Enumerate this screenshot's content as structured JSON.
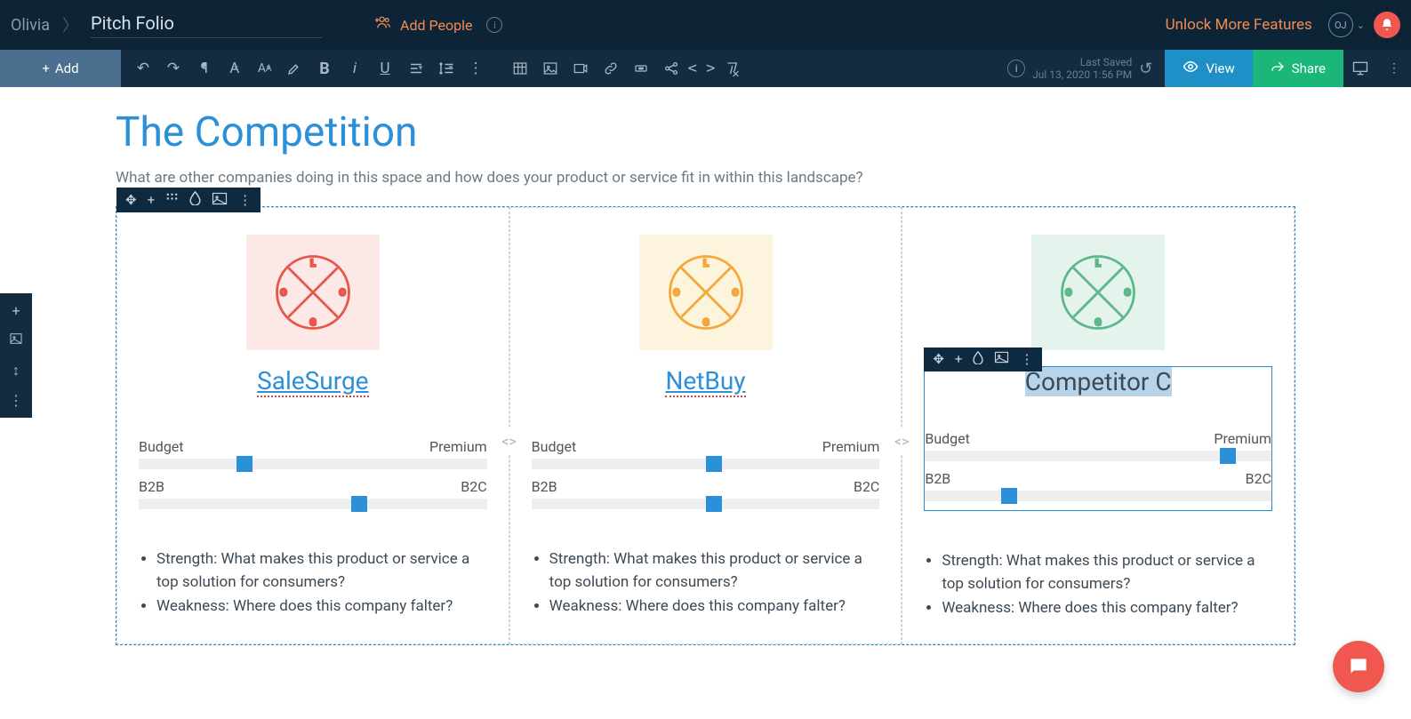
{
  "header": {
    "owner": "Olivia",
    "doc_title": "Pitch Folio",
    "add_people": "Add People",
    "unlock": "Unlock More Features",
    "avatar_initials": "OJ"
  },
  "toolbar": {
    "add": "+ Add",
    "last_saved_label": "Last Saved",
    "last_saved_time": "Jul 13, 2020 1:56 PM",
    "view": "View",
    "share": "Share"
  },
  "doc": {
    "title": "The Competition",
    "subtitle": "What are other companies doing in this space and how does your product or service fit in within this landscape?",
    "competitors": [
      {
        "name": "SaleSurge",
        "style": "link",
        "logo_color": "red",
        "slider1": {
          "left": "Budget",
          "right": "Premium",
          "pos": 28
        },
        "slider2": {
          "left": "B2B",
          "right": "B2C",
          "pos": 61
        },
        "strength": "Strength: What makes this product or service a top solution for consumers?",
        "weakness": "Weakness: Where does this company falter?"
      },
      {
        "name": "NetBuy",
        "style": "link",
        "logo_color": "yel",
        "slider1": {
          "left": "Budget",
          "right": "Premium",
          "pos": 50
        },
        "slider2": {
          "left": "B2B",
          "right": "B2C",
          "pos": 50
        },
        "strength": "Strength: What makes this product or service a top solution for consumers?",
        "weakness": "Weakness: Where does this company falter?"
      },
      {
        "name": "Competitor C",
        "style": "selected",
        "logo_color": "grn",
        "slider1": {
          "left": "Budget",
          "right": "Premium",
          "pos": 85
        },
        "slider2": {
          "left": "B2B",
          "right": "B2C",
          "pos": 22
        },
        "strength": "Strength: What makes this product or service a top solution for consumers?",
        "weakness": "Weakness: Where does this company falter?"
      }
    ]
  }
}
